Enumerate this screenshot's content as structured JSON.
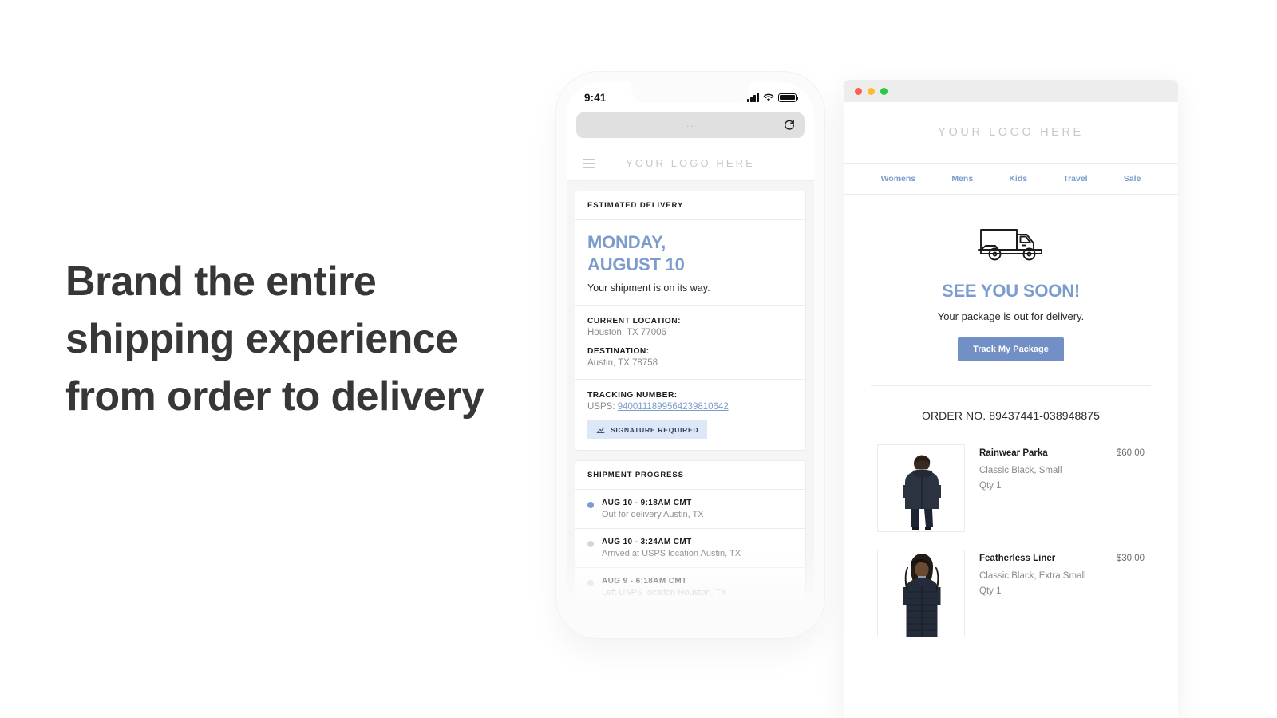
{
  "headline": "Brand the entire shipping experience from order to delivery",
  "phone": {
    "status": {
      "time": "9:41",
      "signal_icon": "cellular-bars-icon",
      "wifi_icon": "wifi-icon",
      "battery_icon": "battery-full-icon"
    },
    "browser": {
      "url_placeholder": "",
      "url_value": "",
      "reload_icon": "reload-icon"
    },
    "brandbar": {
      "menu_icon": "hamburger-menu-icon",
      "logo": "YOUR LOGO HERE"
    },
    "delivery_card": {
      "header": "ESTIMATED DELIVERY",
      "date_line1": "MONDAY,",
      "date_line2": "AUGUST 10",
      "subtitle": "Your shipment is on its way.",
      "current_location_label": "CURRENT LOCATION:",
      "current_location_value": "Houston, TX 77006",
      "destination_label": "DESTINATION:",
      "destination_value": "Austin, TX 78758",
      "tracking_label": "TRACKING NUMBER:",
      "tracking_carrier": "USPS:",
      "tracking_number": "9400111899564239810642",
      "signature_badge": "SIGNATURE REQUIRED",
      "signature_icon": "signature-pen-icon"
    },
    "progress_card": {
      "header": "SHIPMENT PROGRESS",
      "events": [
        {
          "time": "AUG 10 - 9:18AM CMT",
          "desc": "Out for delivery Austin, TX",
          "active": true
        },
        {
          "time": "AUG 10 - 3:24AM CMT",
          "desc": "Arrived at USPS location Austin, TX",
          "active": false
        },
        {
          "time": "AUG 9 - 6:18AM CMT",
          "desc": "Left USPS location Houston, TX",
          "active": false
        }
      ]
    }
  },
  "browser": {
    "traffic_lights": {
      "close": "close-window-button",
      "minimize": "minimize-window-button",
      "maximize": "maximize-window-button"
    },
    "logo": "YOUR LOGO HERE",
    "nav": [
      {
        "label": "Womens"
      },
      {
        "label": "Mens"
      },
      {
        "label": "Kids"
      },
      {
        "label": "Travel"
      },
      {
        "label": "Sale"
      }
    ],
    "hero": {
      "truck_icon": "delivery-truck-icon",
      "title": "SEE YOU SOON!",
      "subtitle": "Your package is out for delivery.",
      "button": "Track My Package"
    },
    "order_number": "ORDER NO. 89437441-038948875",
    "items": [
      {
        "name": "Rainwear Parka",
        "price": "$60.00",
        "variant": "Classic Black, Small",
        "qty": "Qty 1",
        "thumb_alt": "model-wearing-black-rainwear-parka"
      },
      {
        "name": "Featherless Liner",
        "price": "$30.00",
        "variant": "Classic Black, Extra Small",
        "qty": "Qty 1",
        "thumb_alt": "model-wearing-black-featherless-liner"
      }
    ]
  },
  "colors": {
    "accent_blue": "#7b9ccd",
    "button_blue": "#7390c6",
    "badge_blue_bg": "#dce7f7",
    "text_dark": "#1b1b1b",
    "text_muted": "#8a8a8a",
    "headline": "#373737"
  }
}
